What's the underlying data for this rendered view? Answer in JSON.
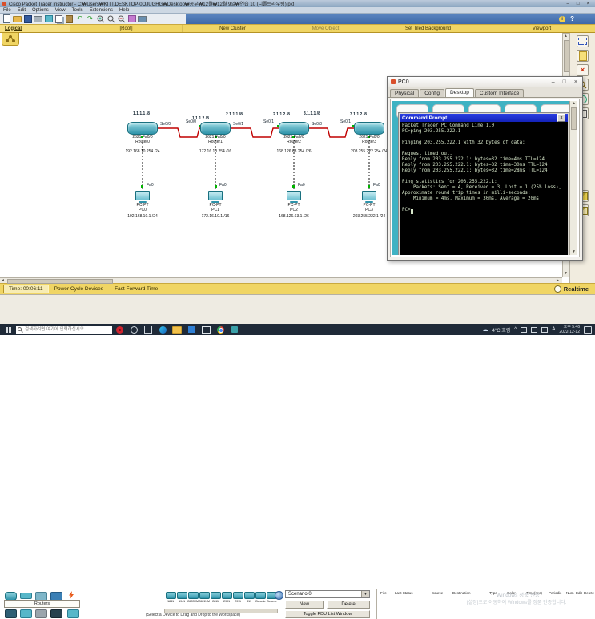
{
  "titlebar": {
    "title": "Cisco Packet Tracer Instructor - C:₩Users₩KITT.DESKTOP-0OJUGHG₩Desktop₩공부₩12월₩12월 9일₩연습 10 (디폴트라우팅).pkt"
  },
  "icons": {
    "minimize": "–",
    "maximize": "□",
    "close": "×",
    "up": "▲",
    "down": "▼",
    "left": "◄",
    "right": "►",
    "undo": "↶",
    "redo": "↷",
    "dropdown": "▼",
    "info": "i",
    "help": "?",
    "cmd_close": "x",
    "cloud": "☁",
    "chevron": "^"
  },
  "menubar": {
    "items": [
      "File",
      "Edit",
      "Options",
      "View",
      "Tools",
      "Extensions",
      "Help"
    ]
  },
  "wsbar": {
    "logical": "Logical",
    "root": "[Root]",
    "new_cluster": "New Cluster",
    "move_object": "Move Object",
    "set_tiled": "Set Tiled Background",
    "viewport": "Viewport"
  },
  "topology": {
    "ip_labels": [
      "1.1.1.1 /8",
      "1.1.1.2 /8",
      "2.1.1.1 /8",
      "2.1.1.2 /8",
      "3.1.1.1 /8",
      "3.1.1.2 /8"
    ],
    "port_labels": [
      "Se0/0",
      "Se0/0",
      "Se0/1",
      "Se0/1",
      "Se0/0",
      "Se0/1"
    ],
    "routers": [
      {
        "model": "2621",
        "iface": "Fa0/0",
        "name": "Router0",
        "note": "192.168.10.254 /24"
      },
      {
        "model": "2621",
        "iface": "Fa0/0",
        "name": "Router1",
        "note": "172.16.10.254 /16"
      },
      {
        "model": "2621",
        "iface": "Fa0/0",
        "name": "Router2",
        "note": "168.126.63.254 /26"
      },
      {
        "model": "2621",
        "iface": "Fa0/0",
        "name": "Router3",
        "note": "203.255.222.254 /24"
      }
    ],
    "pcs": [
      {
        "model": "PC-PT",
        "name": "PC0",
        "note": "192.168.10.1 /24",
        "iface": "Fa0"
      },
      {
        "model": "PC-PT",
        "name": "PC1",
        "note": "172.16.10.1 /16",
        "iface": "Fa0"
      },
      {
        "model": "PC-PT",
        "name": "PC2",
        "note": "168.126.63.1 /26",
        "iface": "Fa0"
      },
      {
        "model": "PC-PT",
        "name": "PC3",
        "note": "203.255.222.1 /24",
        "iface": "Fa0"
      }
    ]
  },
  "pc_window": {
    "title": "PC0",
    "tabs": [
      "Physical",
      "Config",
      "Desktop",
      "Custom Interface"
    ],
    "cmd_title": "Command Prompt",
    "terminal": "Packet Tracer PC Command Line 1.0\nPC>ping 203.255.222.1\n\nPinging 203.255.222.1 with 32 bytes of data:\n\nRequest timed out.\nReply from 203.255.222.1: bytes=32 time=4ms TTL=124\nReply from 203.255.222.1: bytes=32 time=30ms TTL=124\nReply from 203.255.222.1: bytes=32 time=28ms TTL=124\n\nPing statistics for 203.255.222.1:\n    Packets: Sent = 4, Received = 3, Lost = 1 (25% loss),\nApproximate round trip times in milli-seconds:\n    Minimum = 4ms, Maximum = 30ms, Average = 20ms\n\nPC>"
  },
  "bottom": {
    "time_label": "Time: 00:06:11",
    "power_cycle": "Power Cycle Devices",
    "fast_forward": "Fast Forward Time",
    "realtime": "Realtime",
    "category_label": "Routers",
    "models": [
      "1841",
      "1941",
      "2620XM",
      "2621XM",
      "2811",
      "2901",
      "2911",
      "819",
      "Generic",
      "Generic"
    ],
    "hint": "(Select a Device to Drag and Drop to the Workspace)",
    "scenario": {
      "selected": "Scenario 0",
      "new_btn": "New",
      "delete_btn": "Delete",
      "toggle_btn": "Toggle PDU List Window"
    },
    "pdu_headers": [
      "Fire",
      "Last Status",
      "Source",
      "Destination",
      "Type",
      "Color",
      "Time(sec)",
      "Periodic",
      "Num",
      "Edit",
      "Delete"
    ]
  },
  "watermark": {
    "line1": "Windows 정품 인증",
    "line2": "[설정]으로 이동하여 Windows를 정품 인증합니다."
  },
  "taskbar": {
    "search_placeholder": "검색하려면 여기에 입력하십시오",
    "weather": "4°C 흐림",
    "ime": "A",
    "time": "오후 5:46",
    "date": "2022-12-12"
  }
}
